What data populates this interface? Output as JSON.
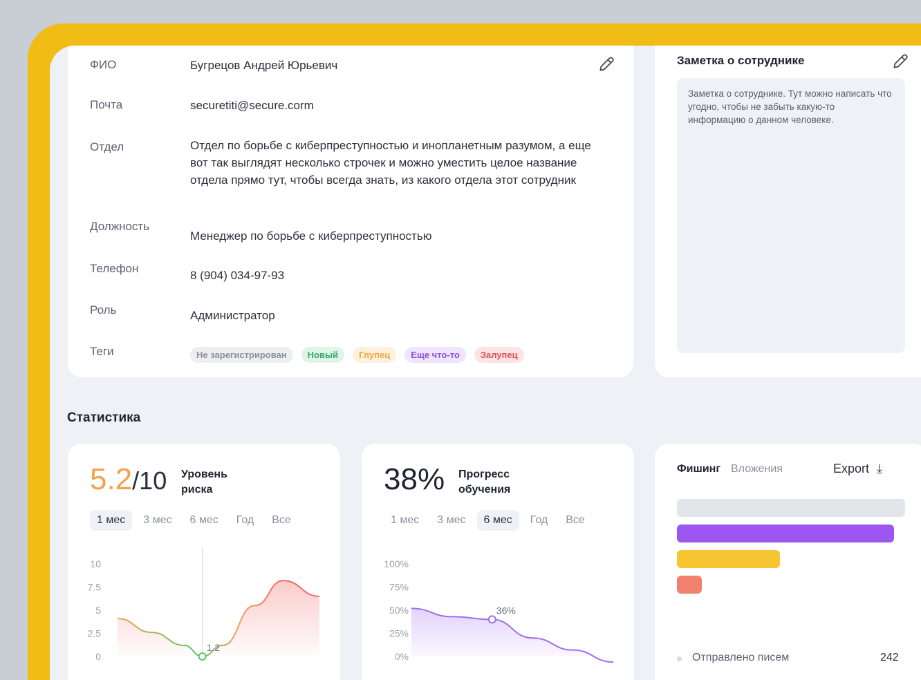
{
  "employee": {
    "fields": [
      {
        "label": "ФИО",
        "value": "Бугрецов Андрей Юрьевич"
      },
      {
        "label": "Почта",
        "value": "securetiti@secure.corm"
      },
      {
        "label": "Отдел",
        "value": "Отдел по борьбе с киберпреступностью и инопланетным разумом, а еще вот так выглядят несколько строчек и можно уместить целое название отдела прямо тут, чтобы всегда знать, из какого отдела этот сотрудник"
      },
      {
        "label": "Должность",
        "value": "Менеджер по борьбе с киберпреступностью"
      },
      {
        "label": "Телефон",
        "value": "8 (904) 034-97-93"
      },
      {
        "label": "Роль",
        "value": "Администратор"
      },
      {
        "label": "Теги",
        "value": ""
      }
    ],
    "tags": [
      {
        "text": "Не зарегистрирован",
        "color": "#8a909c",
        "bg": "#eceef2"
      },
      {
        "text": "Новый",
        "color": "#3aa86a",
        "bg": "#e0f4e8"
      },
      {
        "text": "Глупец",
        "color": "#f0a840",
        "bg": "#fdf0dc"
      },
      {
        "text": "Еще что-то",
        "color": "#8a4fe0",
        "bg": "#efe6fc"
      },
      {
        "text": "Залупец",
        "color": "#e05252",
        "bg": "#fde3e3"
      }
    ]
  },
  "note": {
    "title": "Заметка о сотруднике",
    "text": "Заметка о сотруднике. Тут можно написать что угодно, чтобы не забыть какую-то информацию о данном человеке."
  },
  "statistics": {
    "title": "Статистика"
  },
  "risk": {
    "value": "5.2",
    "denominator": "/10",
    "label_line1": "Уровень",
    "label_line2": "риска",
    "periods": [
      "1 мес",
      "3 мес",
      "6 мес",
      "Год",
      "Все"
    ],
    "active_period": 0
  },
  "progress": {
    "value": "38%",
    "label_line1": "Прогресс",
    "label_line2": "обучения",
    "periods": [
      "1 мес",
      "3 мес",
      "6 мес",
      "Год",
      "Все"
    ],
    "active_period": 2
  },
  "phishing": {
    "tab_active": "Фишинг",
    "tab_inactive": "Вложения",
    "export_label": "Export",
    "legend_label": "Отправлено писем",
    "legend_value": "242",
    "bars": [
      {
        "value": 1.0,
        "color": "#e2e5ea"
      },
      {
        "value": 0.95,
        "color": "#9d55f0"
      },
      {
        "value": 0.45,
        "color": "#f7c531"
      },
      {
        "value": 0.11,
        "color": "#f2806e"
      }
    ]
  },
  "chart_data": [
    {
      "type": "area",
      "y_ticks": [
        "10",
        "7.5",
        "5",
        "2.5",
        "0"
      ],
      "ylim": [
        0,
        10
      ],
      "points": [
        {
          "x": 0.0,
          "y": 4.1
        },
        {
          "x": 0.17,
          "y": 2.6
        },
        {
          "x": 0.33,
          "y": 1.2
        },
        {
          "x": 0.42,
          "y": 0.0
        },
        {
          "x": 0.52,
          "y": 1.2
        },
        {
          "x": 0.68,
          "y": 5.5
        },
        {
          "x": 0.82,
          "y": 8.2
        },
        {
          "x": 1.0,
          "y": 6.5
        }
      ],
      "highlight": {
        "x": 0.42,
        "y": 0.0,
        "label": "1.2"
      }
    },
    {
      "type": "area",
      "y_ticks": [
        "100%",
        "75%",
        "50%",
        "25%",
        "0%"
      ],
      "ylim": [
        0,
        100
      ],
      "points": [
        {
          "x": 0.0,
          "y": 52
        },
        {
          "x": 0.2,
          "y": 43
        },
        {
          "x": 0.4,
          "y": 40
        },
        {
          "x": 0.6,
          "y": 20
        },
        {
          "x": 0.8,
          "y": 7
        },
        {
          "x": 1.0,
          "y": -6
        }
      ],
      "highlight": {
        "x": 0.4,
        "y": 40,
        "label": "36%"
      }
    }
  ]
}
